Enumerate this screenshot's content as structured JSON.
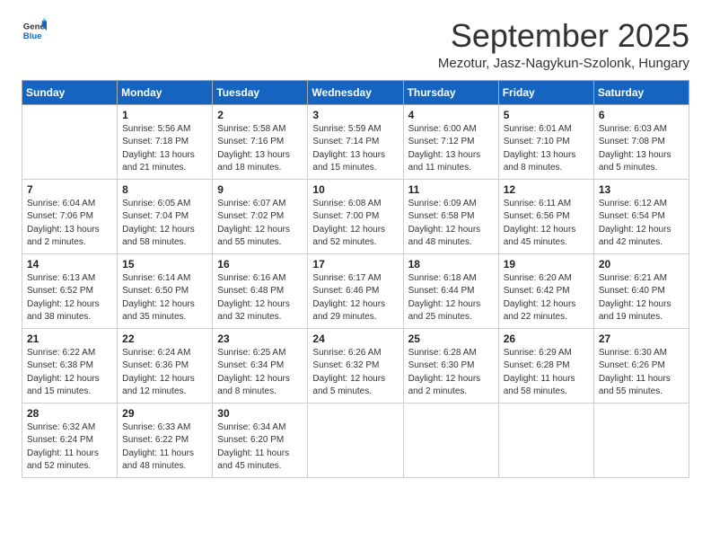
{
  "header": {
    "logo_general": "General",
    "logo_blue": "Blue",
    "month_title": "September 2025",
    "location": "Mezotur, Jasz-Nagykun-Szolonk, Hungary"
  },
  "days_of_week": [
    "Sunday",
    "Monday",
    "Tuesday",
    "Wednesday",
    "Thursday",
    "Friday",
    "Saturday"
  ],
  "weeks": [
    [
      {
        "day": "",
        "detail": ""
      },
      {
        "day": "1",
        "detail": "Sunrise: 5:56 AM\nSunset: 7:18 PM\nDaylight: 13 hours\nand 21 minutes."
      },
      {
        "day": "2",
        "detail": "Sunrise: 5:58 AM\nSunset: 7:16 PM\nDaylight: 13 hours\nand 18 minutes."
      },
      {
        "day": "3",
        "detail": "Sunrise: 5:59 AM\nSunset: 7:14 PM\nDaylight: 13 hours\nand 15 minutes."
      },
      {
        "day": "4",
        "detail": "Sunrise: 6:00 AM\nSunset: 7:12 PM\nDaylight: 13 hours\nand 11 minutes."
      },
      {
        "day": "5",
        "detail": "Sunrise: 6:01 AM\nSunset: 7:10 PM\nDaylight: 13 hours\nand 8 minutes."
      },
      {
        "day": "6",
        "detail": "Sunrise: 6:03 AM\nSunset: 7:08 PM\nDaylight: 13 hours\nand 5 minutes."
      }
    ],
    [
      {
        "day": "7",
        "detail": "Sunrise: 6:04 AM\nSunset: 7:06 PM\nDaylight: 13 hours\nand 2 minutes."
      },
      {
        "day": "8",
        "detail": "Sunrise: 6:05 AM\nSunset: 7:04 PM\nDaylight: 12 hours\nand 58 minutes."
      },
      {
        "day": "9",
        "detail": "Sunrise: 6:07 AM\nSunset: 7:02 PM\nDaylight: 12 hours\nand 55 minutes."
      },
      {
        "day": "10",
        "detail": "Sunrise: 6:08 AM\nSunset: 7:00 PM\nDaylight: 12 hours\nand 52 minutes."
      },
      {
        "day": "11",
        "detail": "Sunrise: 6:09 AM\nSunset: 6:58 PM\nDaylight: 12 hours\nand 48 minutes."
      },
      {
        "day": "12",
        "detail": "Sunrise: 6:11 AM\nSunset: 6:56 PM\nDaylight: 12 hours\nand 45 minutes."
      },
      {
        "day": "13",
        "detail": "Sunrise: 6:12 AM\nSunset: 6:54 PM\nDaylight: 12 hours\nand 42 minutes."
      }
    ],
    [
      {
        "day": "14",
        "detail": "Sunrise: 6:13 AM\nSunset: 6:52 PM\nDaylight: 12 hours\nand 38 minutes."
      },
      {
        "day": "15",
        "detail": "Sunrise: 6:14 AM\nSunset: 6:50 PM\nDaylight: 12 hours\nand 35 minutes."
      },
      {
        "day": "16",
        "detail": "Sunrise: 6:16 AM\nSunset: 6:48 PM\nDaylight: 12 hours\nand 32 minutes."
      },
      {
        "day": "17",
        "detail": "Sunrise: 6:17 AM\nSunset: 6:46 PM\nDaylight: 12 hours\nand 29 minutes."
      },
      {
        "day": "18",
        "detail": "Sunrise: 6:18 AM\nSunset: 6:44 PM\nDaylight: 12 hours\nand 25 minutes."
      },
      {
        "day": "19",
        "detail": "Sunrise: 6:20 AM\nSunset: 6:42 PM\nDaylight: 12 hours\nand 22 minutes."
      },
      {
        "day": "20",
        "detail": "Sunrise: 6:21 AM\nSunset: 6:40 PM\nDaylight: 12 hours\nand 19 minutes."
      }
    ],
    [
      {
        "day": "21",
        "detail": "Sunrise: 6:22 AM\nSunset: 6:38 PM\nDaylight: 12 hours\nand 15 minutes."
      },
      {
        "day": "22",
        "detail": "Sunrise: 6:24 AM\nSunset: 6:36 PM\nDaylight: 12 hours\nand 12 minutes."
      },
      {
        "day": "23",
        "detail": "Sunrise: 6:25 AM\nSunset: 6:34 PM\nDaylight: 12 hours\nand 8 minutes."
      },
      {
        "day": "24",
        "detail": "Sunrise: 6:26 AM\nSunset: 6:32 PM\nDaylight: 12 hours\nand 5 minutes."
      },
      {
        "day": "25",
        "detail": "Sunrise: 6:28 AM\nSunset: 6:30 PM\nDaylight: 12 hours\nand 2 minutes."
      },
      {
        "day": "26",
        "detail": "Sunrise: 6:29 AM\nSunset: 6:28 PM\nDaylight: 11 hours\nand 58 minutes."
      },
      {
        "day": "27",
        "detail": "Sunrise: 6:30 AM\nSunset: 6:26 PM\nDaylight: 11 hours\nand 55 minutes."
      }
    ],
    [
      {
        "day": "28",
        "detail": "Sunrise: 6:32 AM\nSunset: 6:24 PM\nDaylight: 11 hours\nand 52 minutes."
      },
      {
        "day": "29",
        "detail": "Sunrise: 6:33 AM\nSunset: 6:22 PM\nDaylight: 11 hours\nand 48 minutes."
      },
      {
        "day": "30",
        "detail": "Sunrise: 6:34 AM\nSunset: 6:20 PM\nDaylight: 11 hours\nand 45 minutes."
      },
      {
        "day": "",
        "detail": ""
      },
      {
        "day": "",
        "detail": ""
      },
      {
        "day": "",
        "detail": ""
      },
      {
        "day": "",
        "detail": ""
      }
    ]
  ]
}
